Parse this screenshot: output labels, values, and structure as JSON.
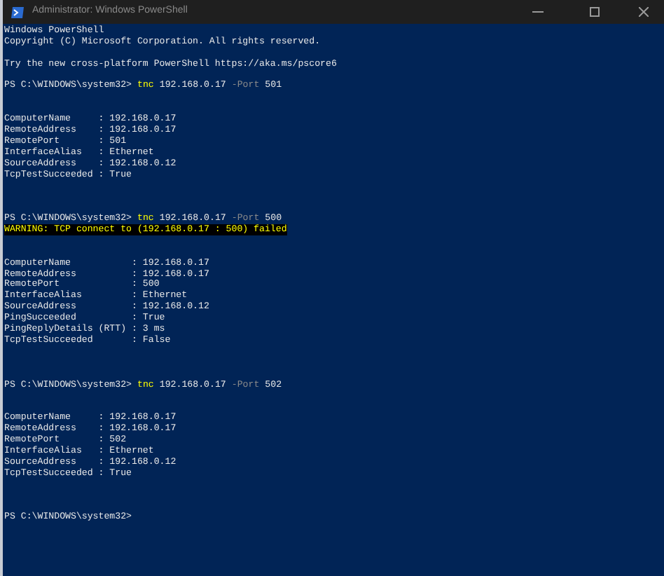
{
  "window": {
    "title": "Administrator: Windows PowerShell"
  },
  "lines": [
    {
      "kind": "output",
      "text": "Windows PowerShell"
    },
    {
      "kind": "output",
      "text": "Copyright (C) Microsoft Corporation. All rights reserved."
    },
    {
      "kind": "blank"
    },
    {
      "kind": "output",
      "text": "Try the new cross-platform PowerShell https://aka.ms/pscore6"
    },
    {
      "kind": "blank"
    },
    {
      "kind": "prompt",
      "prompt": "PS C:\\WINDOWS\\system32>",
      "command": "tnc",
      "argument": "192.168.0.17",
      "parameter": "-Port",
      "value": "501"
    },
    {
      "kind": "blank"
    },
    {
      "kind": "blank"
    },
    {
      "kind": "output",
      "text": "ComputerName     : 192.168.0.17"
    },
    {
      "kind": "output",
      "text": "RemoteAddress    : 192.168.0.17"
    },
    {
      "kind": "output",
      "text": "RemotePort       : 501"
    },
    {
      "kind": "output",
      "text": "InterfaceAlias   : Ethernet"
    },
    {
      "kind": "output",
      "text": "SourceAddress    : 192.168.0.12"
    },
    {
      "kind": "output",
      "text": "TcpTestSucceeded : True"
    },
    {
      "kind": "blank"
    },
    {
      "kind": "blank"
    },
    {
      "kind": "blank"
    },
    {
      "kind": "prompt",
      "prompt": "PS C:\\WINDOWS\\system32>",
      "command": "tnc",
      "argument": "192.168.0.17",
      "parameter": "-Port",
      "value": "500"
    },
    {
      "kind": "warning",
      "text": "WARNING: TCP connect to (192.168.0.17 : 500) failed"
    },
    {
      "kind": "blank"
    },
    {
      "kind": "blank"
    },
    {
      "kind": "output",
      "text": "ComputerName           : 192.168.0.17"
    },
    {
      "kind": "output",
      "text": "RemoteAddress          : 192.168.0.17"
    },
    {
      "kind": "output",
      "text": "RemotePort             : 500"
    },
    {
      "kind": "output",
      "text": "InterfaceAlias         : Ethernet"
    },
    {
      "kind": "output",
      "text": "SourceAddress          : 192.168.0.12"
    },
    {
      "kind": "output",
      "text": "PingSucceeded          : True"
    },
    {
      "kind": "output",
      "text": "PingReplyDetails (RTT) : 3 ms"
    },
    {
      "kind": "output",
      "text": "TcpTestSucceeded       : False"
    },
    {
      "kind": "blank"
    },
    {
      "kind": "blank"
    },
    {
      "kind": "blank"
    },
    {
      "kind": "prompt",
      "prompt": "PS C:\\WINDOWS\\system32>",
      "command": "tnc",
      "argument": "192.168.0.17",
      "parameter": "-Port",
      "value": "502"
    },
    {
      "kind": "blank"
    },
    {
      "kind": "blank"
    },
    {
      "kind": "output",
      "text": "ComputerName     : 192.168.0.17"
    },
    {
      "kind": "output",
      "text": "RemoteAddress    : 192.168.0.17"
    },
    {
      "kind": "output",
      "text": "RemotePort       : 502"
    },
    {
      "kind": "output",
      "text": "InterfaceAlias   : Ethernet"
    },
    {
      "kind": "output",
      "text": "SourceAddress    : 192.168.0.12"
    },
    {
      "kind": "output",
      "text": "TcpTestSucceeded : True"
    },
    {
      "kind": "blank"
    },
    {
      "kind": "blank"
    },
    {
      "kind": "blank"
    },
    {
      "kind": "prompt",
      "prompt": "PS C:\\WINDOWS\\system32>"
    }
  ]
}
